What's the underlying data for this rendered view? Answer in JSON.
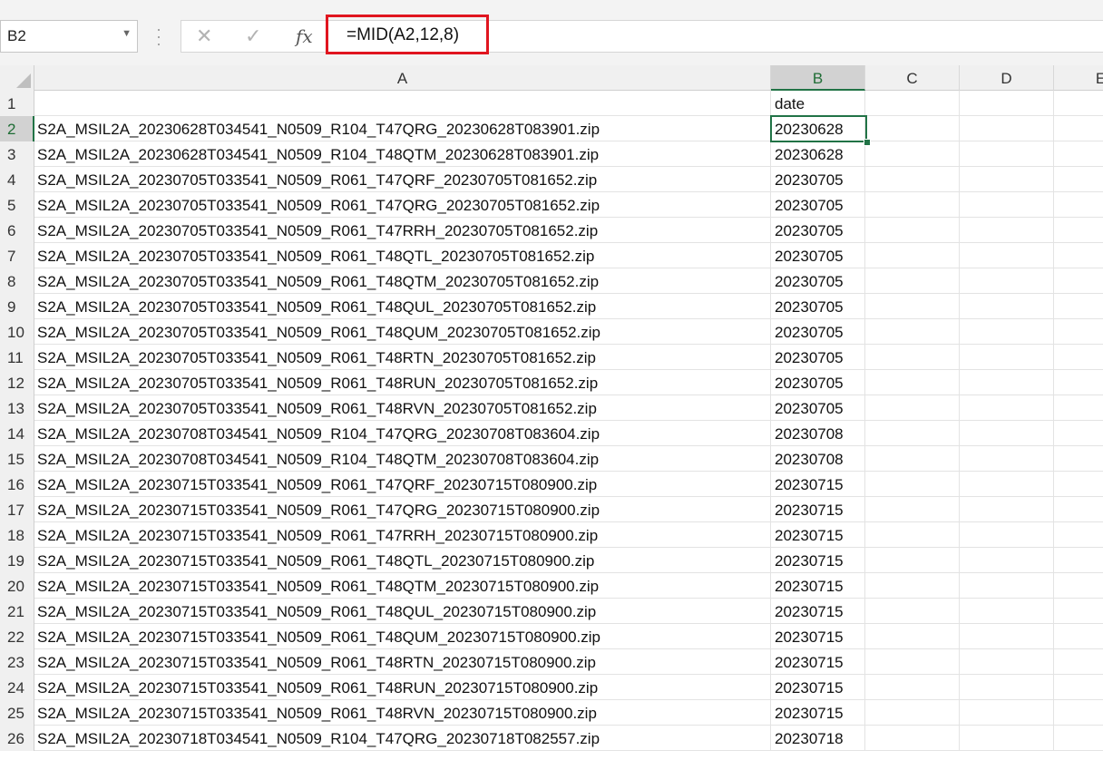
{
  "formula_bar": {
    "name_box": "B2",
    "formula": "=MID(A2,12,8)",
    "icons": {
      "cancel": "close-icon",
      "enter": "check-icon",
      "function": "fx-icon"
    }
  },
  "accent_color": "#217346",
  "highlight_color": "#e0151f",
  "columns": [
    "A",
    "B",
    "C",
    "D",
    "E"
  ],
  "selected_cell": "B2",
  "rows": [
    {
      "n": "1",
      "a": "",
      "b": "date"
    },
    {
      "n": "2",
      "a": "S2A_MSIL2A_20230628T034541_N0509_R104_T47QRG_20230628T083901.zip",
      "b": "20230628"
    },
    {
      "n": "3",
      "a": "S2A_MSIL2A_20230628T034541_N0509_R104_T48QTM_20230628T083901.zip",
      "b": "20230628"
    },
    {
      "n": "4",
      "a": "S2A_MSIL2A_20230705T033541_N0509_R061_T47QRF_20230705T081652.zip",
      "b": "20230705"
    },
    {
      "n": "5",
      "a": "S2A_MSIL2A_20230705T033541_N0509_R061_T47QRG_20230705T081652.zip",
      "b": "20230705"
    },
    {
      "n": "6",
      "a": "S2A_MSIL2A_20230705T033541_N0509_R061_T47RRH_20230705T081652.zip",
      "b": "20230705"
    },
    {
      "n": "7",
      "a": "S2A_MSIL2A_20230705T033541_N0509_R061_T48QTL_20230705T081652.zip",
      "b": "20230705"
    },
    {
      "n": "8",
      "a": "S2A_MSIL2A_20230705T033541_N0509_R061_T48QTM_20230705T081652.zip",
      "b": "20230705"
    },
    {
      "n": "9",
      "a": "S2A_MSIL2A_20230705T033541_N0509_R061_T48QUL_20230705T081652.zip",
      "b": "20230705"
    },
    {
      "n": "10",
      "a": "S2A_MSIL2A_20230705T033541_N0509_R061_T48QUM_20230705T081652.zip",
      "b": "20230705"
    },
    {
      "n": "11",
      "a": "S2A_MSIL2A_20230705T033541_N0509_R061_T48RTN_20230705T081652.zip",
      "b": "20230705"
    },
    {
      "n": "12",
      "a": "S2A_MSIL2A_20230705T033541_N0509_R061_T48RUN_20230705T081652.zip",
      "b": "20230705"
    },
    {
      "n": "13",
      "a": "S2A_MSIL2A_20230705T033541_N0509_R061_T48RVN_20230705T081652.zip",
      "b": "20230705"
    },
    {
      "n": "14",
      "a": "S2A_MSIL2A_20230708T034541_N0509_R104_T47QRG_20230708T083604.zip",
      "b": "20230708"
    },
    {
      "n": "15",
      "a": "S2A_MSIL2A_20230708T034541_N0509_R104_T48QTM_20230708T083604.zip",
      "b": "20230708"
    },
    {
      "n": "16",
      "a": "S2A_MSIL2A_20230715T033541_N0509_R061_T47QRF_20230715T080900.zip",
      "b": "20230715"
    },
    {
      "n": "17",
      "a": "S2A_MSIL2A_20230715T033541_N0509_R061_T47QRG_20230715T080900.zip",
      "b": "20230715"
    },
    {
      "n": "18",
      "a": "S2A_MSIL2A_20230715T033541_N0509_R061_T47RRH_20230715T080900.zip",
      "b": "20230715"
    },
    {
      "n": "19",
      "a": "S2A_MSIL2A_20230715T033541_N0509_R061_T48QTL_20230715T080900.zip",
      "b": "20230715"
    },
    {
      "n": "20",
      "a": "S2A_MSIL2A_20230715T033541_N0509_R061_T48QTM_20230715T080900.zip",
      "b": "20230715"
    },
    {
      "n": "21",
      "a": "S2A_MSIL2A_20230715T033541_N0509_R061_T48QUL_20230715T080900.zip",
      "b": "20230715"
    },
    {
      "n": "22",
      "a": "S2A_MSIL2A_20230715T033541_N0509_R061_T48QUM_20230715T080900.zip",
      "b": "20230715"
    },
    {
      "n": "23",
      "a": "S2A_MSIL2A_20230715T033541_N0509_R061_T48RTN_20230715T080900.zip",
      "b": "20230715"
    },
    {
      "n": "24",
      "a": "S2A_MSIL2A_20230715T033541_N0509_R061_T48RUN_20230715T080900.zip",
      "b": "20230715"
    },
    {
      "n": "25",
      "a": "S2A_MSIL2A_20230715T033541_N0509_R061_T48RVN_20230715T080900.zip",
      "b": "20230715"
    },
    {
      "n": "26",
      "a": "S2A_MSIL2A_20230718T034541_N0509_R104_T47QRG_20230718T082557.zip",
      "b": "20230718"
    }
  ]
}
